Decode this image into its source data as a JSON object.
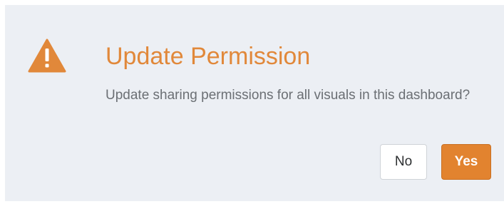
{
  "dialog": {
    "icon": "warning-icon",
    "title": "Update Permission",
    "message": "Update sharing permissions for all visuals in this dashboard?",
    "buttons": {
      "no_label": "No",
      "yes_label": "Yes"
    },
    "colors": {
      "background": "#eceff4",
      "accent": "#e1883a",
      "primary_button": "#e2832f",
      "text": "#6b6f74"
    }
  }
}
